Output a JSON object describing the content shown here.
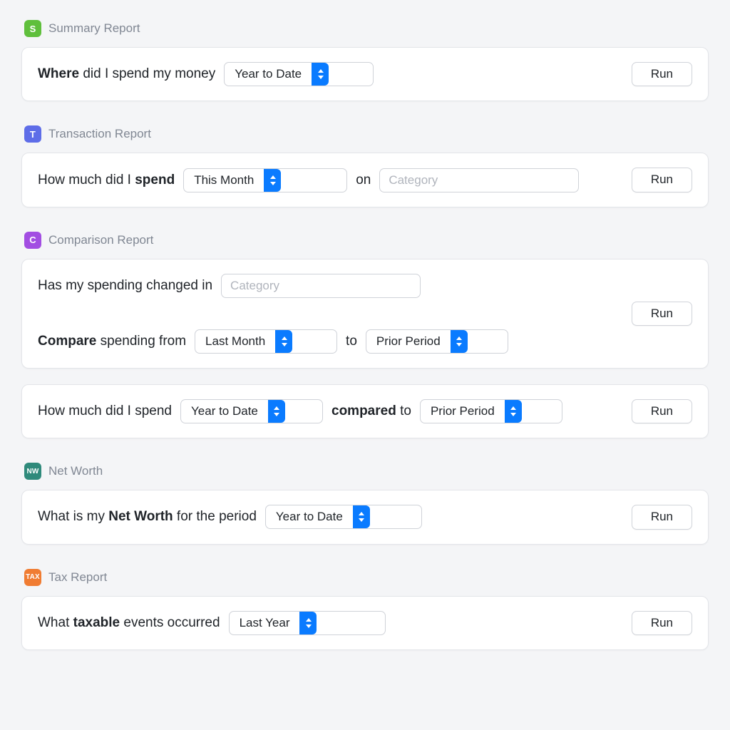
{
  "sections": {
    "summary": {
      "icon_letter": "S",
      "title": "Summary Report",
      "line1": {
        "prefix_bold": "Where",
        "prefix_rest": " did I spend my money",
        "select": "Year to Date"
      },
      "run": "Run"
    },
    "transaction": {
      "icon_letter": "T",
      "title": "Transaction Report",
      "line1": {
        "prefix": "How much did I ",
        "bold": "spend",
        "select": "This Month",
        "mid": "on",
        "placeholder": "Category"
      },
      "run": "Run"
    },
    "comparison": {
      "icon_letter": "C",
      "title": "Comparison Report",
      "card1": {
        "row1": {
          "text": "Has my spending changed in",
          "placeholder": "Category"
        },
        "row2": {
          "bold": "Compare",
          "rest": " spending from",
          "select1": "Last Month",
          "mid": "to",
          "select2": "Prior Period"
        },
        "run": "Run"
      },
      "card2": {
        "text": "How much did I spend",
        "select1": "Year to Date",
        "mid_bold": "compared",
        "mid_rest": " to",
        "select2": "Prior Period",
        "run": "Run"
      }
    },
    "networth": {
      "icon_letter": "NW",
      "title": "Net Worth",
      "line1": {
        "prefix": "What is my ",
        "bold": "Net Worth",
        "suffix": " for the period",
        "select": "Year to Date"
      },
      "run": "Run"
    },
    "tax": {
      "icon_letter": "TAX",
      "title": "Tax Report",
      "line1": {
        "prefix": "What ",
        "bold": "taxable",
        "suffix": " events occurred",
        "select": "Last Year"
      },
      "run": "Run"
    }
  }
}
